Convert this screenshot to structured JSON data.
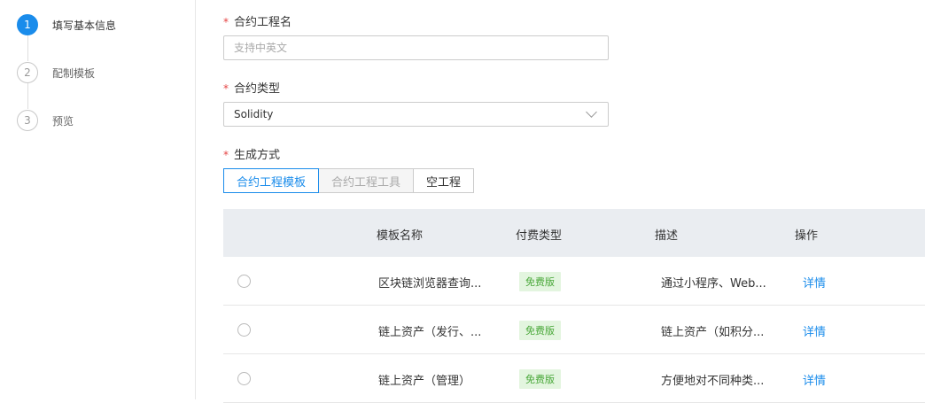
{
  "steps": [
    {
      "num": "1",
      "label": "填写基本信息",
      "active": true
    },
    {
      "num": "2",
      "label": "配制模板",
      "active": false
    },
    {
      "num": "3",
      "label": "预览",
      "active": false
    }
  ],
  "form": {
    "required_mark": "*",
    "name_label": "合约工程名",
    "name_placeholder": "支持中英文",
    "type_label": "合约类型",
    "type_value": "Solidity",
    "gen_label": "生成方式",
    "gen_options": [
      "合约工程模板",
      "合约工程工具",
      "空工程"
    ]
  },
  "table": {
    "headers": [
      "模板名称",
      "付费类型",
      "描述",
      "操作"
    ],
    "rows": [
      {
        "name": "区块链浏览器查询...",
        "fee": "免费版",
        "desc": "通过小程序、Web...",
        "action": "详情"
      },
      {
        "name": "链上资产（发行、...",
        "fee": "免费版",
        "desc": "链上资产（如积分...",
        "action": "详情"
      },
      {
        "name": "链上资产（管理）",
        "fee": "免费版",
        "desc": "方便地对不同种类...",
        "action": "详情"
      }
    ]
  },
  "colors": {
    "accent": "#1a8ceb",
    "required": "#e54545",
    "badge_bg": "#e3f5df",
    "badge_text": "#4aa83a"
  }
}
